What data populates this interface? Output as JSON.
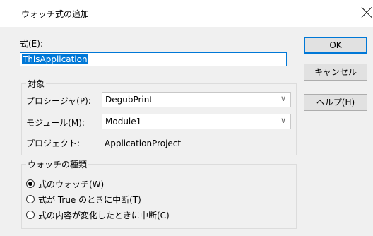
{
  "window": {
    "title": "ウォッチ式の追加"
  },
  "expression": {
    "label": "式(E):",
    "value": "ThisApplication"
  },
  "target_group": {
    "title": "対象",
    "procedure_label": "プロシージャ(P):",
    "procedure_value": "DegubPrint",
    "module_label": "モジュール(M):",
    "module_value": "Module1",
    "project_label": "プロジェクト:",
    "project_value": "ApplicationProject"
  },
  "watch_type_group": {
    "title": "ウォッチの種類",
    "options": [
      {
        "label": "式のウォッチ(W)",
        "selected": true
      },
      {
        "label": "式が True のときに中断(T)",
        "selected": false
      },
      {
        "label": "式の内容が変化したときに中断(C)",
        "selected": false
      }
    ]
  },
  "buttons": {
    "ok": "OK",
    "cancel": "キャンセル",
    "help": "ヘルプ(H)"
  },
  "icons": {
    "dropdown": "chevron-down-icon",
    "close": "close-icon"
  }
}
